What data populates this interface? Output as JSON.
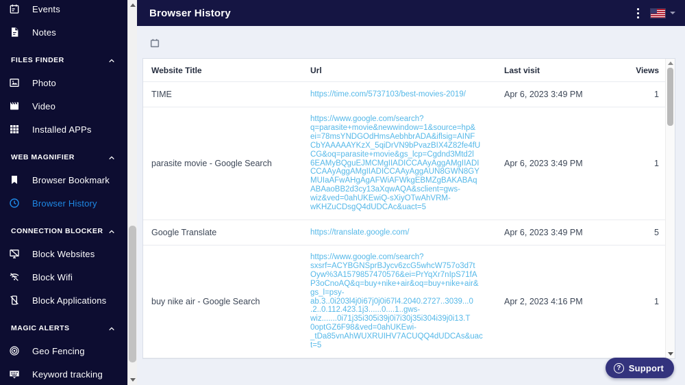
{
  "sidebar": {
    "items": [
      {
        "type": "item",
        "label": "Events",
        "icon": "calendar-event-icon",
        "active": false
      },
      {
        "type": "item",
        "label": "Notes",
        "icon": "note-icon",
        "active": false
      },
      {
        "type": "section",
        "label": "FILES FINDER"
      },
      {
        "type": "item",
        "label": "Photo",
        "icon": "photo-icon",
        "active": false
      },
      {
        "type": "item",
        "label": "Video",
        "icon": "video-icon",
        "active": false
      },
      {
        "type": "item",
        "label": "Installed APPs",
        "icon": "apps-grid-icon",
        "active": false
      },
      {
        "type": "section",
        "label": "WEB MAGNIFIER"
      },
      {
        "type": "item",
        "label": "Browser Bookmark",
        "icon": "bookmark-icon",
        "active": false
      },
      {
        "type": "item",
        "label": "Browser History",
        "icon": "clock-icon",
        "active": true
      },
      {
        "type": "section",
        "label": "CONNECTION BLOCKER"
      },
      {
        "type": "item",
        "label": "Block Websites",
        "icon": "monitor-block-icon",
        "active": false
      },
      {
        "type": "item",
        "label": "Block Wifi",
        "icon": "wifi-off-icon",
        "active": false
      },
      {
        "type": "item",
        "label": "Block Applications",
        "icon": "phone-block-icon",
        "active": false
      },
      {
        "type": "section",
        "label": "MAGIC ALERTS"
      },
      {
        "type": "item",
        "label": "Geo Fencing",
        "icon": "geo-fencing-icon",
        "active": false
      },
      {
        "type": "item",
        "label": "Keyword tracking",
        "icon": "keyboard-icon",
        "active": false
      }
    ]
  },
  "header": {
    "title": "Browser History",
    "icons": [
      "kebab-menu-icon",
      "us-flag-icon",
      "chevron-down-icon"
    ]
  },
  "toolbar": {
    "calendar_icon": "calendar-filter-icon"
  },
  "table": {
    "columns": [
      "Website Title",
      "Url",
      "Last visit",
      "Views"
    ],
    "rows": [
      {
        "title": "TIME",
        "url": "https://time.com/5737103/best-movies-2019/",
        "last_visit": "Apr 6, 2023 3:49 PM",
        "views": "1"
      },
      {
        "title": "parasite movie - Google Search",
        "url": "https://www.google.com/search?\nq=parasite+movie&newwindow=1&source=hp&\nei=78msYNDGOdHmsAebhbrADA&iflsig=AINF\nCbYAAAAAYKzX_5qiDrVN9bPvazBIX4Z82fe4fU\nCG&oq=parasite+movie&gs_lcp=Cgdnd3Mtd2l\n6EAMyBQguEJMCMgIIADICCAAyAggAMgIIADI\nCCAAyAggAMgIIADICCAAyAggAUN8GWN8GY\nMUIaAFwAHgAgAFWiAFWkgEBMZgBAKABAq\nABAaoBB2d3cy13aXqwAQA&sclient=gws-\nwiz&ved=0ahUKEwiQ-sXiyOTwAhVRM-\nwKHZuCDsgQ4dUDCAc&uact=5",
        "last_visit": "Apr 6, 2023 3:49 PM",
        "views": "1"
      },
      {
        "title": "Google Translate",
        "url": "https://translate.google.com/",
        "last_visit": "Apr 6, 2023 3:49 PM",
        "views": "5"
      },
      {
        "title": "buy nike air - Google Search",
        "url": "https://www.google.com/search?\nsxsrf=ACYBGNSprBJycv6zcG5whcW757o3d7t\nOyw%3A1579857470576&ei=PrYqXr7nIpS71fA\nP3oCnoAQ&q=buy+nike+air&oq=buy+nike+air&\ngs_l=psy-\nab.3..0i203l4j0i67j0j0i67l4.2040.2727..3039...0\n.2..0.112.423.1j3......0....1..gws-\nwiz.......0i71j35i305i39j0i7i30j35i304i39j0i13.T\n0optGZ6F98&ved=0ahUKEwi-\n_tDa85vnAhWUXRUIHV7ACUQQ4dUDCAs&uac\nt=5",
        "last_visit": "Apr 2, 2023 4:16 PM",
        "views": "1"
      }
    ]
  },
  "support": {
    "label": "Support"
  },
  "colors": {
    "sidebar_bg": "#0d0d31",
    "header_bg": "#151543",
    "accent_active": "#1e88e5",
    "link_blue": "#55b8e8",
    "content_bg": "#edf0f7",
    "support_bg": "#33337d",
    "scrollbar_thumb": "#c2c2c2"
  }
}
